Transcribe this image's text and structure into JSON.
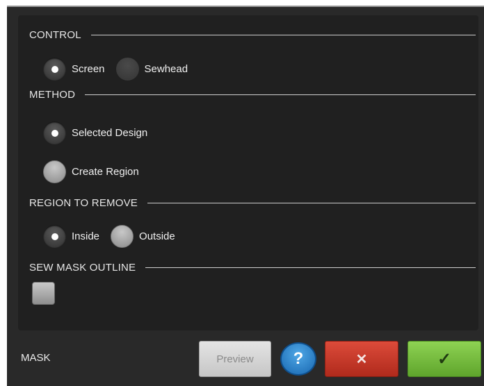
{
  "dialog": {
    "title": "MASK"
  },
  "sections": {
    "control": {
      "header": "CONTROL",
      "options": [
        {
          "label": "Screen",
          "selected": true
        },
        {
          "label": "Sewhead",
          "selected": false
        }
      ]
    },
    "method": {
      "header": "METHOD",
      "options": [
        {
          "label": "Selected Design",
          "selected": true
        },
        {
          "label": "Create Region",
          "selected": false
        }
      ]
    },
    "region_to_remove": {
      "header": "REGION TO REMOVE",
      "options": [
        {
          "label": "Inside",
          "selected": true
        },
        {
          "label": "Outside",
          "selected": false
        }
      ]
    },
    "sew_mask_outline": {
      "header": "SEW MASK OUTLINE",
      "checked": false
    }
  },
  "buttons": {
    "preview_label": "Preview",
    "help_label": "?",
    "cancel_label": "✕",
    "ok_label": "✓"
  },
  "colors": {
    "background": "#292929",
    "panel": "#202020",
    "help": "#2a86d1",
    "cancel": "#c93a2b",
    "ok": "#78be3f"
  }
}
